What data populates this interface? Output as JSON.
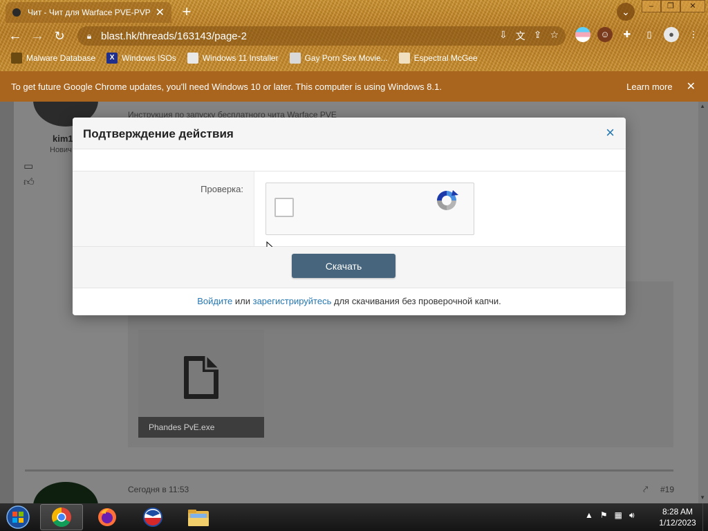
{
  "browser": {
    "tab_title": "Чит - Чит для Warface PVE-PVP",
    "tab_close": "✕",
    "new_tab": "+",
    "url": "blast.hk/threads/163143/page-2",
    "bookmarks": [
      {
        "label": "Malware Database"
      },
      {
        "label": "Windows ISOs"
      },
      {
        "label": "Windows 11 Installer"
      },
      {
        "label": "Gay Porn Sex Movie..."
      },
      {
        "label": "Espectral McGee"
      }
    ],
    "infobar": {
      "message": "To get future Google Chrome updates, you'll need Windows 10 or later. This computer is using Windows 8.1.",
      "learn_more": "Learn more",
      "close": "✕"
    }
  },
  "page": {
    "username": "kim1",
    "rank": "Нович",
    "post_snippet": "Инструкция по запуску бесплатного чита Warface PVE",
    "attachment_name": "Phandes PvE.exe",
    "next_post_date": "Сегодня в 11:53",
    "next_post_number": "#19"
  },
  "modal": {
    "title": "Подтверждение действия",
    "close": "×",
    "verify_label": "Проверка:",
    "download_button": "Скачать",
    "footer": {
      "login_link": "Войдите",
      "or": "или",
      "register_link": "зарегистрируйтесь",
      "suffix": "для скачивания без проверочной капчи."
    }
  },
  "taskbar": {
    "time": "8:28 AM",
    "date": "1/12/2023"
  },
  "colors": {
    "accent_link": "#2577b1",
    "download_button": "#47667d",
    "infobar": "#a9641d"
  }
}
